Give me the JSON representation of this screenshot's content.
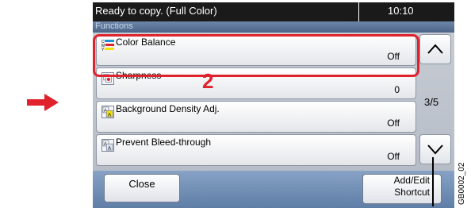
{
  "status_bar": {
    "message": "Ready to copy. (Full Color)",
    "time": "10:10"
  },
  "header": {
    "section_label": "Functions"
  },
  "function_list": [
    {
      "label": "Color Balance",
      "value": "Off",
      "icon": "color-balance-icon"
    },
    {
      "label": "Sharpness",
      "value": "0",
      "icon": "sharpness-icon"
    },
    {
      "label": "Background Density Adj.",
      "value": "Off",
      "icon": "background-density-icon"
    },
    {
      "label": "Prevent Bleed-through",
      "value": "Off",
      "icon": "prevent-bleed-icon"
    }
  ],
  "pagination": {
    "indicator": "3/5"
  },
  "buttons": {
    "close": "Close",
    "add_edit_line1": "Add/Edit",
    "add_edit_line2": "Shortcut"
  },
  "annotations": {
    "step_number": "2",
    "doc_code": "GB0002_02"
  },
  "colors": {
    "highlight": "#e0222d",
    "arrow": "#e0222d",
    "status_bar": "#1a1a1a"
  }
}
